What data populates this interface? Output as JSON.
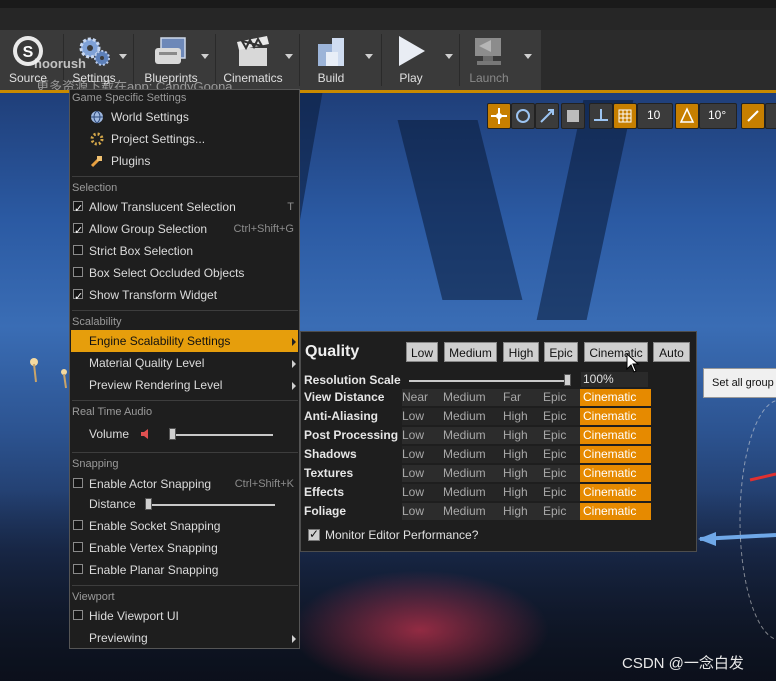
{
  "toolbar": {
    "items": [
      {
        "label": "Source",
        "icon": "source-control-icon",
        "dim": false
      },
      {
        "label": "Settings",
        "icon": "gears-icon",
        "dim": false
      },
      {
        "label": "Blueprints",
        "icon": "blueprint-icon",
        "dim": false
      },
      {
        "label": "Cinematics",
        "icon": "clapperboard-icon",
        "dim": false
      },
      {
        "label": "Build",
        "icon": "build-blocks-icon",
        "dim": false
      },
      {
        "label": "Play",
        "icon": "play-icon",
        "dim": false
      },
      {
        "label": "Launch",
        "icon": "launch-icon",
        "dim": true
      }
    ],
    "overlay_name": "hoorush",
    "overlay_watermark": "更多资源下载在app: CandyGoona"
  },
  "viewport_toolbar": {
    "grid_snap_value": "10",
    "rotation_snap_value": "10°"
  },
  "menu": {
    "sections": {
      "game_specific": "Game Specific Settings",
      "selection": "Selection",
      "scalability": "Scalability",
      "real_time_audio": "Real Time Audio",
      "snapping": "Snapping",
      "viewport": "Viewport"
    },
    "game_items": [
      {
        "label": "World Settings",
        "icon": "globe-icon"
      },
      {
        "label": "Project Settings...",
        "icon": "project-settings-icon"
      },
      {
        "label": "Plugins",
        "icon": "plugin-icon"
      }
    ],
    "selection_items": [
      {
        "label": "Allow Translucent Selection",
        "checked": true,
        "shortcut": "T"
      },
      {
        "label": "Allow Group Selection",
        "checked": true,
        "shortcut": "Ctrl+Shift+G"
      },
      {
        "label": "Strict Box Selection",
        "checked": false,
        "shortcut": ""
      },
      {
        "label": "Box Select Occluded Objects",
        "checked": false,
        "shortcut": ""
      },
      {
        "label": "Show Transform Widget",
        "checked": true,
        "shortcut": ""
      }
    ],
    "scalability_items": [
      {
        "label": "Engine Scalability Settings",
        "highlighted": true
      },
      {
        "label": "Material Quality Level",
        "highlighted": false
      },
      {
        "label": "Preview Rendering Level",
        "highlighted": false
      }
    ],
    "volume_label": "Volume",
    "volume_level": 0.0,
    "snapping_items": [
      {
        "label": "Enable Actor Snapping",
        "checked": false,
        "shortcut": "Ctrl+Shift+K"
      }
    ],
    "distance_label": "Distance",
    "distance_level": 0.0,
    "snapping_items2": [
      {
        "label": "Enable Socket Snapping",
        "checked": false
      },
      {
        "label": "Enable Vertex Snapping",
        "checked": false
      },
      {
        "label": "Enable Planar Snapping",
        "checked": false
      }
    ],
    "viewport_items": [
      {
        "label": "Hide Viewport UI",
        "checked": false,
        "submenu": false
      },
      {
        "label": "Previewing",
        "checked": null,
        "submenu": true
      }
    ]
  },
  "quality": {
    "title": "Quality",
    "buttons": [
      "Low",
      "Medium",
      "High",
      "Epic",
      "Cinematic",
      "Auto"
    ],
    "resolution_label": "Resolution Scale",
    "resolution_value": "100%",
    "resolution_level": 1.0,
    "rows": [
      {
        "label": "View Distance",
        "levels": [
          "Near",
          "Medium",
          "Far",
          "Epic",
          "Cinematic"
        ]
      },
      {
        "label": "Anti-Aliasing",
        "levels": [
          "Low",
          "Medium",
          "High",
          "Epic",
          "Cinematic"
        ]
      },
      {
        "label": "Post Processing",
        "levels": [
          "Low",
          "Medium",
          "High",
          "Epic",
          "Cinematic"
        ]
      },
      {
        "label": "Shadows",
        "levels": [
          "Low",
          "Medium",
          "High",
          "Epic",
          "Cinematic"
        ]
      },
      {
        "label": "Textures",
        "levels": [
          "Low",
          "Medium",
          "High",
          "Epic",
          "Cinematic"
        ]
      },
      {
        "label": "Effects",
        "levels": [
          "Low",
          "Medium",
          "High",
          "Epic",
          "Cinematic"
        ]
      },
      {
        "label": "Foliage",
        "levels": [
          "Low",
          "Medium",
          "High",
          "Epic",
          "Cinematic"
        ]
      }
    ],
    "monitor_label": "Monitor Editor Performance?",
    "monitor_checked": true
  },
  "tooltip": "Set all group",
  "credit": "CSDN @一念白发",
  "colors": {
    "accent": "#e69e0c",
    "selected_level": "#e68a00",
    "menu_bg": "#1e1e1e"
  }
}
